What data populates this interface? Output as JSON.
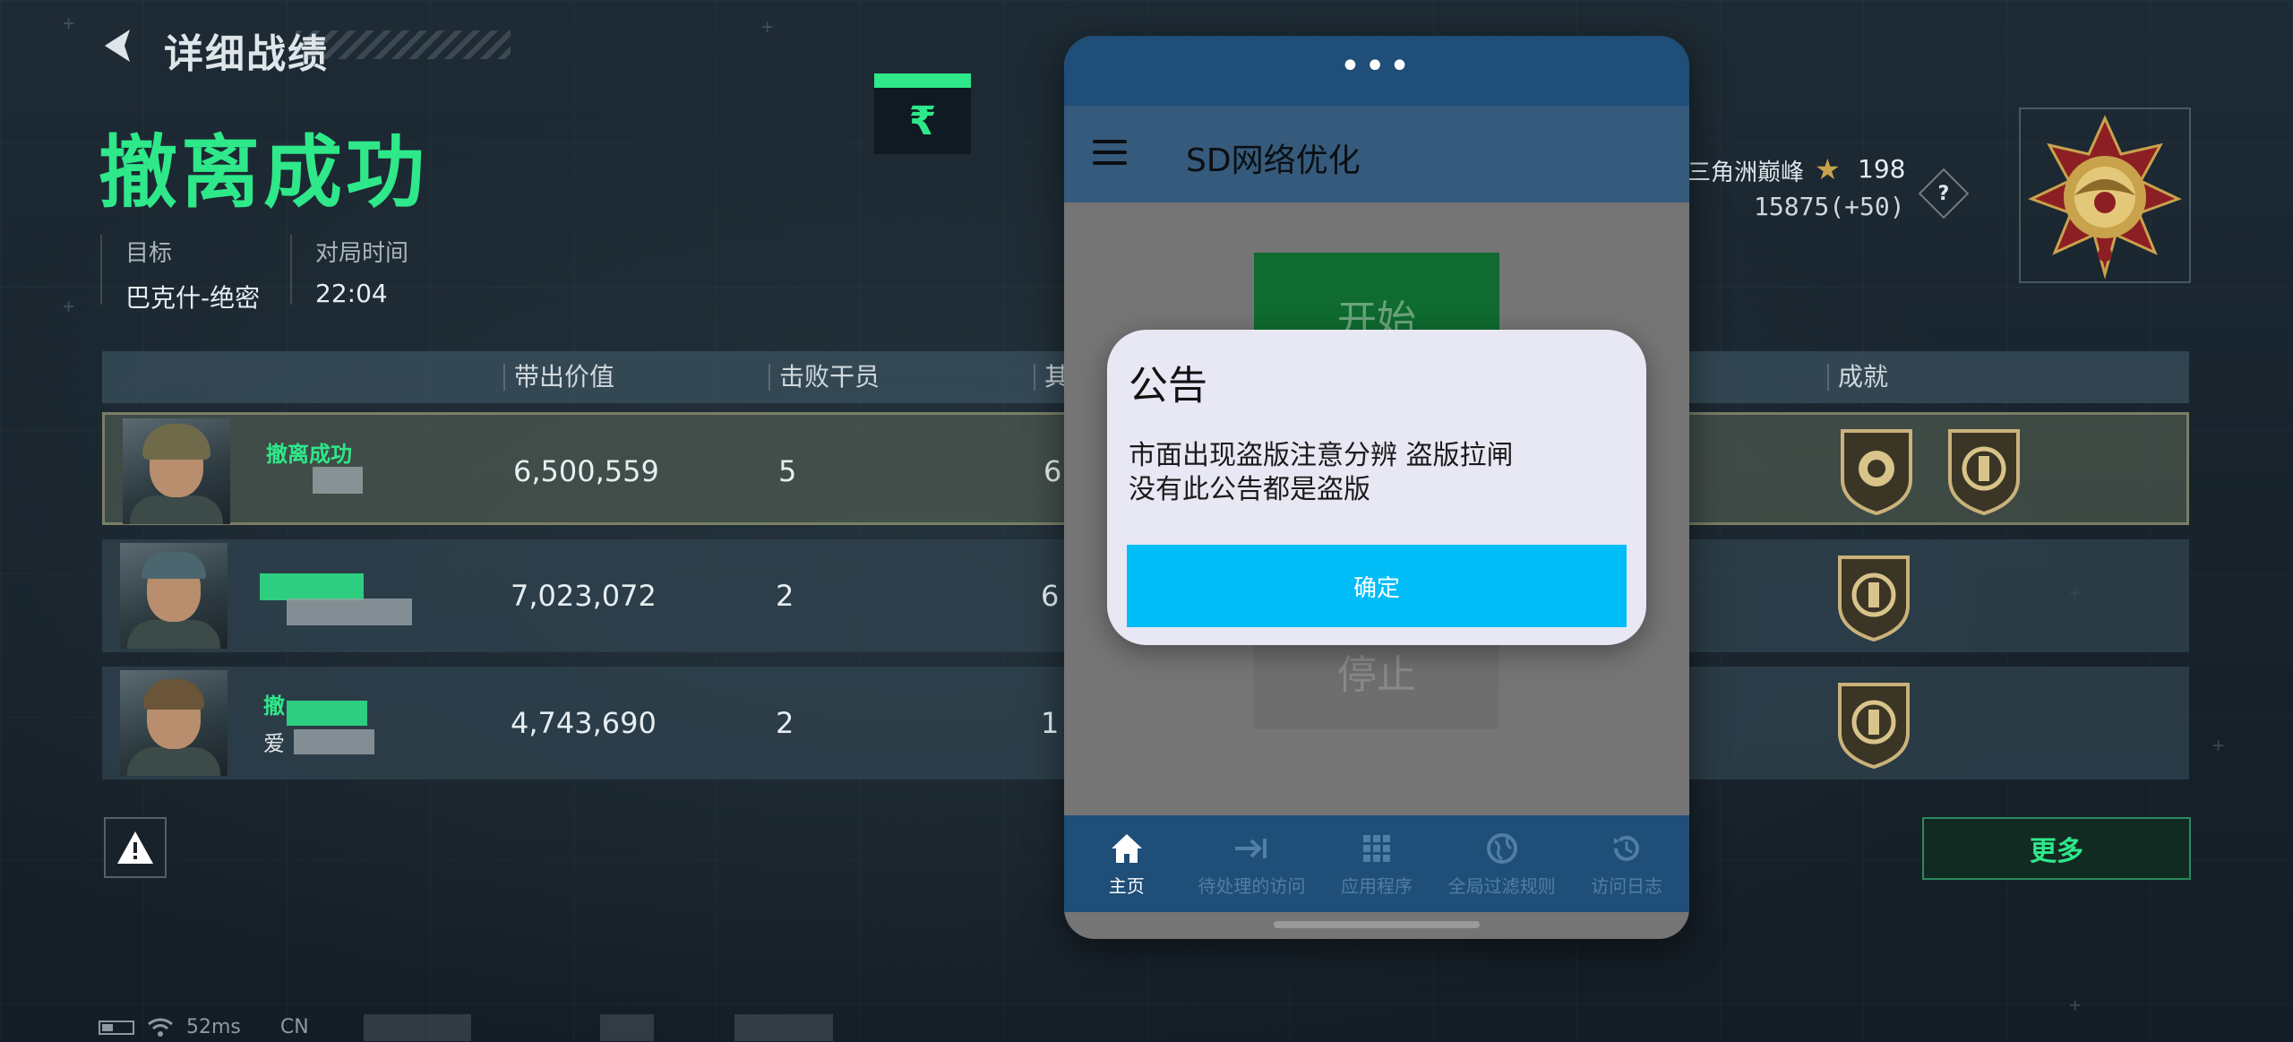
{
  "header": {
    "title": "详细战绩",
    "result": "撤离成功"
  },
  "info": {
    "target_label": "目标",
    "target_value": "巴克什-绝密",
    "time_label": "对局时间",
    "time_value": "22:04"
  },
  "currency_symbol": "₹",
  "rank": {
    "tier": "三角洲巅峰",
    "stars": "198",
    "score": "15875(+50)",
    "help": "?"
  },
  "table": {
    "columns": [
      "带出价值",
      "击败干员",
      "其",
      "成就"
    ],
    "rows": [
      {
        "name": "撤离成功",
        "value": "6,500,559",
        "kills": "5",
        "other": "6"
      },
      {
        "name": "",
        "value": "7,023,072",
        "kills": "2",
        "other": "6"
      },
      {
        "name": "撤",
        "subname": "爱",
        "value": "4,743,690",
        "kills": "2",
        "other": "1"
      }
    ]
  },
  "buttons": {
    "more": "更多"
  },
  "status": {
    "ping": "52ms",
    "region": "CN"
  },
  "app": {
    "dots": "•••",
    "title": "SD网络优化",
    "start": "开始",
    "stop": "停止",
    "nav": [
      {
        "label": "主页",
        "icon": "home-icon"
      },
      {
        "label": "待处理的访问",
        "icon": "arrow-right-bar-icon"
      },
      {
        "label": "应用程序",
        "icon": "grid-icon"
      },
      {
        "label": "全局过滤规则",
        "icon": "globe-icon"
      },
      {
        "label": "访问日志",
        "icon": "history-icon"
      }
    ]
  },
  "dialog": {
    "title": "公告",
    "message": "市面出现盗版注意分辨 盗版拉闸\n没有此公告都是盗版",
    "confirm": "确定"
  },
  "colors": {
    "accent_green": "#2ee88a",
    "dialog_button": "#00bdf7",
    "app_bar": "#1f4e78"
  }
}
